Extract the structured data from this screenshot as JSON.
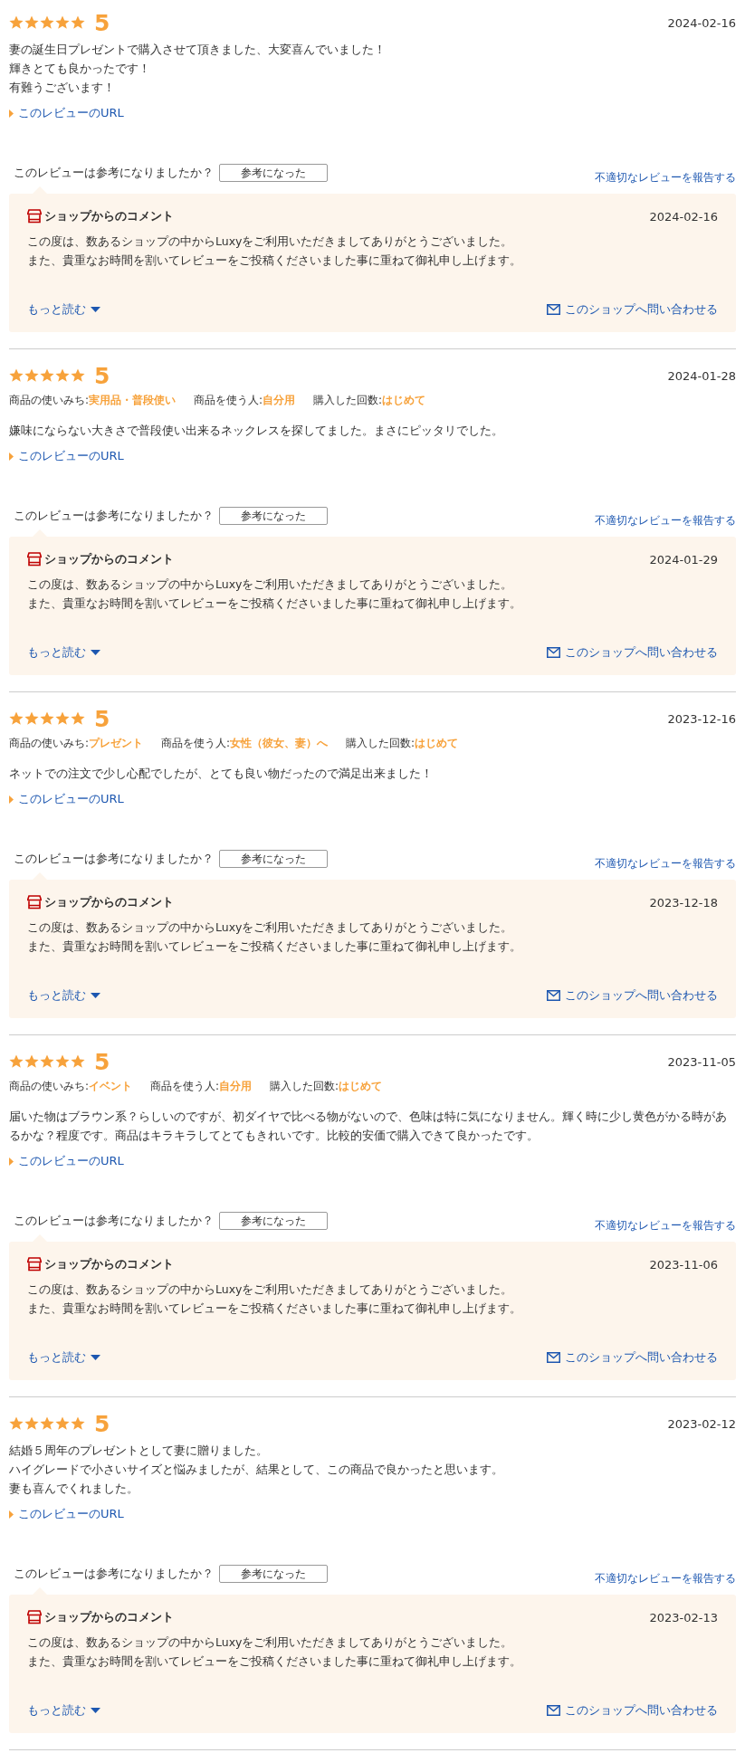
{
  "reviews": [
    {
      "stars": 5,
      "score": "5",
      "date": "2024-02-16",
      "body": [
        "妻の誕生日プレゼントで購入させて頂きました、大変喜んでいました！",
        "輝きとても良かったです！",
        "有難うございます！"
      ],
      "url_link": "このレビューのURL",
      "helpful_question": "このレビューは参考になりましたか？",
      "helpful_button": "参考になった",
      "report_link": "不適切なレビューを報告する",
      "shop_comment": {
        "title": "ショップからのコメント",
        "date": "2024-02-16",
        "body": [
          "この度は、数あるショップの中からLuxyをご利用いただきましてありがとうございました。",
          "また、貴重なお時間を割いてレビューをご投稿くださいました事に重ねて御礼申し上げます。"
        ],
        "more_link": "もっと読む",
        "contact_link": "このショップへ問い合わせる"
      }
    },
    {
      "stars": 5,
      "score": "5",
      "date": "2024-01-28",
      "attributes": [
        {
          "label": "商品の使いみち:",
          "value": "実用品・普段使い"
        },
        {
          "label": "商品を使う人:",
          "value": "自分用"
        },
        {
          "label": "購入した回数:",
          "value": "はじめて"
        }
      ],
      "body": [
        "嫌味にならない大きさで普段使い出来るネックレスを探してました。まさにピッタリでした。"
      ],
      "url_link": "このレビューのURL",
      "helpful_question": "このレビューは参考になりましたか？",
      "helpful_button": "参考になった",
      "report_link": "不適切なレビューを報告する",
      "shop_comment": {
        "title": "ショップからのコメント",
        "date": "2024-01-29",
        "body": [
          "この度は、数あるショップの中からLuxyをご利用いただきましてありがとうございました。",
          "また、貴重なお時間を割いてレビューをご投稿くださいました事に重ねて御礼申し上げます。"
        ],
        "more_link": "もっと読む",
        "contact_link": "このショップへ問い合わせる"
      }
    },
    {
      "stars": 5,
      "score": "5",
      "date": "2023-12-16",
      "attributes": [
        {
          "label": "商品の使いみち:",
          "value": "プレゼント"
        },
        {
          "label": "商品を使う人:",
          "value": "女性（彼女、妻）へ"
        },
        {
          "label": "購入した回数:",
          "value": "はじめて"
        }
      ],
      "body": [
        "ネットでの注文で少し心配でしたが、とても良い物だったので満足出来ました！"
      ],
      "url_link": "このレビューのURL",
      "helpful_question": "このレビューは参考になりましたか？",
      "helpful_button": "参考になった",
      "report_link": "不適切なレビューを報告する",
      "shop_comment": {
        "title": "ショップからのコメント",
        "date": "2023-12-18",
        "body": [
          "この度は、数あるショップの中からLuxyをご利用いただきましてありがとうございました。",
          "また、貴重なお時間を割いてレビューをご投稿くださいました事に重ねて御礼申し上げます。"
        ],
        "more_link": "もっと読む",
        "contact_link": "このショップへ問い合わせる"
      }
    },
    {
      "stars": 5,
      "score": "5",
      "date": "2023-11-05",
      "attributes": [
        {
          "label": "商品の使いみち:",
          "value": "イベント"
        },
        {
          "label": "商品を使う人:",
          "value": "自分用"
        },
        {
          "label": "購入した回数:",
          "value": "はじめて"
        }
      ],
      "body": [
        "届いた物はブラウン系？らしいのですが、初ダイヤで比べる物がないので、色味は特に気になりません。輝く時に少し黄色がかる時があるかな？程度です。商品はキラキラしてとてもきれいです。比較的安価で購入できて良かったです。"
      ],
      "url_link": "このレビューのURL",
      "helpful_question": "このレビューは参考になりましたか？",
      "helpful_button": "参考になった",
      "report_link": "不適切なレビューを報告する",
      "shop_comment": {
        "title": "ショップからのコメント",
        "date": "2023-11-06",
        "body": [
          "この度は、数あるショップの中からLuxyをご利用いただきましてありがとうございました。",
          "また、貴重なお時間を割いてレビューをご投稿くださいました事に重ねて御礼申し上げます。"
        ],
        "more_link": "もっと読む",
        "contact_link": "このショップへ問い合わせる"
      }
    },
    {
      "stars": 5,
      "score": "5",
      "date": "2023-02-12",
      "body": [
        "結婚５周年のプレゼントとして妻に贈りました。",
        "ハイグレードで小さいサイズと悩みましたが、結果として、この商品で良かったと思います。",
        "妻も喜んでくれました。"
      ],
      "url_link": "このレビューのURL",
      "helpful_question": "このレビューは参考になりましたか？",
      "helpful_button": "参考になった",
      "report_link": "不適切なレビューを報告する",
      "shop_comment": {
        "title": "ショップからのコメント",
        "date": "2023-02-13",
        "body": [
          "この度は、数あるショップの中からLuxyをご利用いただきましてありがとうございました。",
          "また、貴重なお時間を割いてレビューをご投稿くださいました事に重ねて御礼申し上げます。"
        ],
        "more_link": "もっと読む",
        "contact_link": "このショップへ問い合わせる"
      }
    }
  ]
}
